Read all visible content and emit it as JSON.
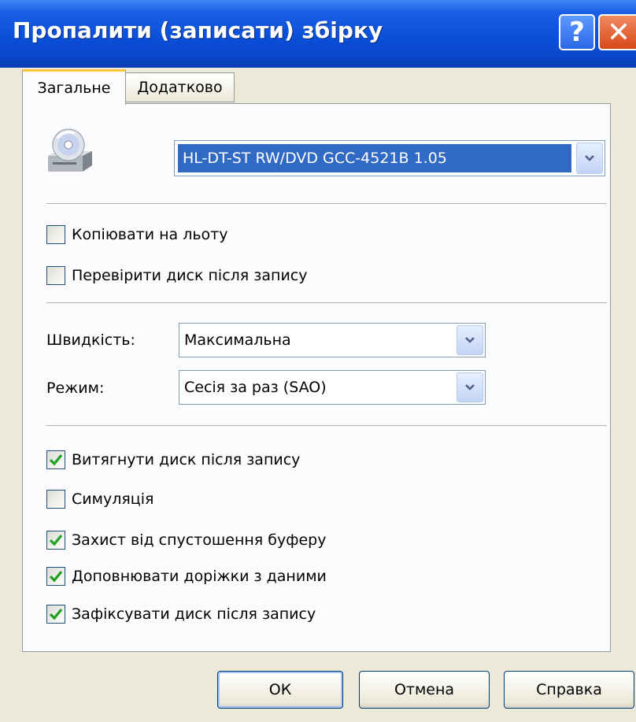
{
  "window": {
    "title": "Пропалити (записати) збірку"
  },
  "titlebar": {
    "help_glyph": "?",
    "close_glyph": "✕"
  },
  "tabs": [
    {
      "label": "Загальне",
      "active": true
    },
    {
      "label": "Додатково",
      "active": false
    }
  ],
  "drive": {
    "selected": "HL-DT-ST RW/DVD GCC-4521B 1.05"
  },
  "options_top": [
    {
      "label": "Копіювати на льоту",
      "checked": false
    },
    {
      "label": "Перевірити диск після запису",
      "checked": false
    }
  ],
  "speed": {
    "label": "Швидкість:",
    "value": "Максимальна"
  },
  "mode": {
    "label": "Режим:",
    "value": "Сесія за раз (SAO)"
  },
  "options_bottom": [
    {
      "label": "Витягнути диск після запису",
      "checked": true
    },
    {
      "label": "Симуляція",
      "checked": false
    },
    {
      "label": "Захист від спустошення буферу",
      "checked": true
    },
    {
      "label": "Доповнювати доріжки з даними",
      "checked": true
    },
    {
      "label": "Зафіксувати диск після запису",
      "checked": true
    }
  ],
  "buttons": {
    "ok": "ОК",
    "cancel": "Отмена",
    "help": "Справка"
  },
  "colors": {
    "titlebar": "#0a4fd8",
    "selection": "#316ac5",
    "check": "#21a121",
    "dialog_bg": "#ece9d8"
  }
}
